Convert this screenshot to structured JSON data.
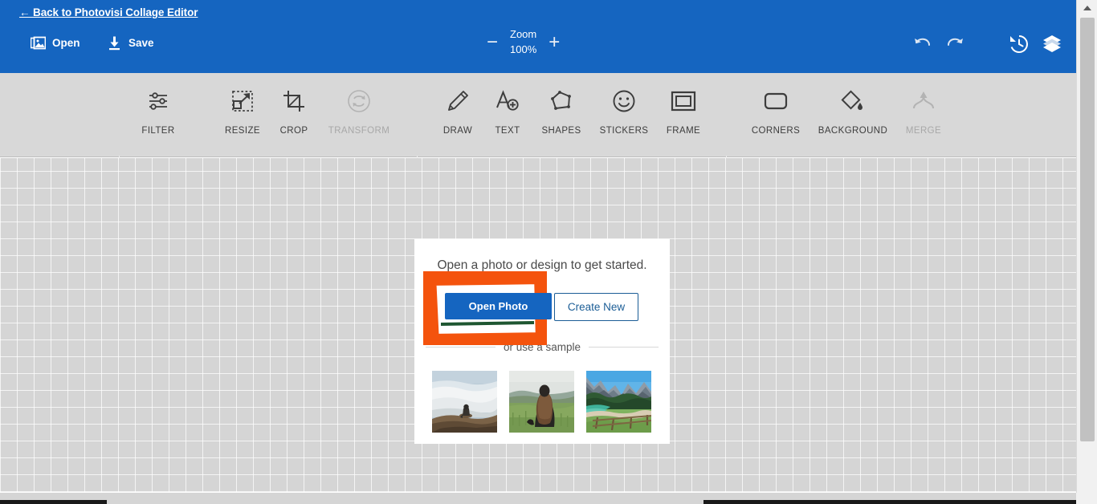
{
  "header": {
    "back_link": "← Back to Photovisi Collage Editor",
    "open_label": "Open",
    "save_label": "Save",
    "zoom_title": "Zoom",
    "zoom_value": "100%",
    "zoom_out": "−",
    "zoom_in": "+",
    "accent_blue": "#1565c0"
  },
  "toolbar": {
    "items": [
      {
        "label": "FILTER",
        "icon": "sliders-icon",
        "disabled": false
      },
      {
        "label": "RESIZE",
        "icon": "resize-arrow-icon",
        "disabled": false
      },
      {
        "label": "CROP",
        "icon": "crop-icon",
        "disabled": false
      },
      {
        "label": "TRANSFORM",
        "icon": "rotate-circle-icon",
        "disabled": true
      },
      {
        "label": "DRAW",
        "icon": "pencil-icon",
        "disabled": false
      },
      {
        "label": "TEXT",
        "icon": "text-add-icon",
        "disabled": false
      },
      {
        "label": "SHAPES",
        "icon": "polygon-icon",
        "disabled": false
      },
      {
        "label": "STICKERS",
        "icon": "smiley-icon",
        "disabled": false
      },
      {
        "label": "FRAME",
        "icon": "frame-icon",
        "disabled": false
      },
      {
        "label": "CORNERS",
        "icon": "rounded-rect-icon",
        "disabled": false
      },
      {
        "label": "BACKGROUND",
        "icon": "paint-bucket-icon",
        "disabled": false
      },
      {
        "label": "MERGE",
        "icon": "merge-arrow-icon",
        "disabled": true
      }
    ]
  },
  "dialog": {
    "title": "Open a photo or design to get started.",
    "open_photo_label": "Open Photo",
    "create_new_label": "Create New",
    "sample_label": "or use a sample",
    "samples": [
      {
        "name": "person-on-cliff-above-clouds"
      },
      {
        "name": "woman-in-grass-field"
      },
      {
        "name": "mountain-lake-with-fence"
      }
    ]
  },
  "annotation": {
    "name": "orange-highlight-rectangle",
    "color": "#f4530d"
  },
  "right_icons": [
    {
      "name": "undo-icon"
    },
    {
      "name": "redo-icon"
    },
    {
      "name": "history-icon"
    },
    {
      "name": "layers-icon"
    }
  ]
}
